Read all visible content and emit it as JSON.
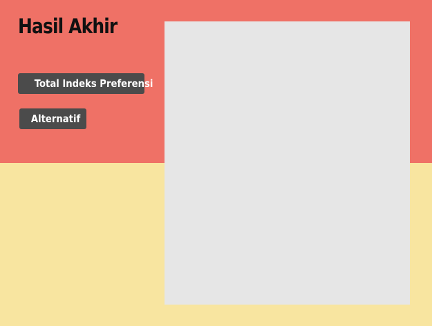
{
  "header": {
    "title": "Hasil Akhir"
  },
  "menu": {
    "total_label": "Total Indeks Preferensi",
    "alternatif_label": "Alternatif"
  },
  "panel": {
    "content": ""
  },
  "colors": {
    "top_background": "#ef7166",
    "bottom_background": "#f8e5a0",
    "button_background": "#4b4b4b",
    "button_text": "#ffffff",
    "panel_background": "#e6e6e6",
    "title_text": "#111111"
  }
}
